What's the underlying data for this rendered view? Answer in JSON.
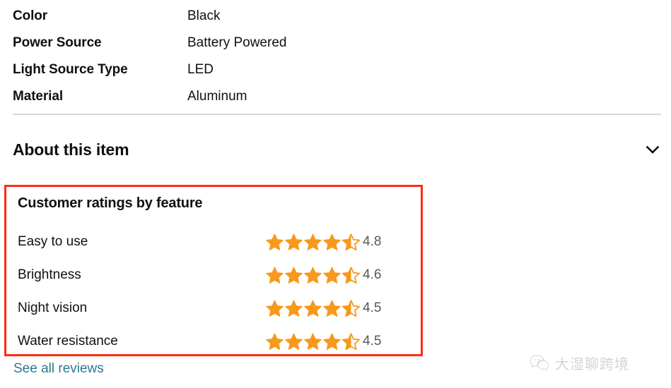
{
  "specs": {
    "rows": [
      {
        "label": "Color",
        "value": "Black"
      },
      {
        "label": "Power Source",
        "value": "Battery Powered"
      },
      {
        "label": "Light Source Type",
        "value": "LED"
      },
      {
        "label": "Material",
        "value": "Aluminum"
      }
    ]
  },
  "about": {
    "title": "About this item",
    "expand_icon": "chevron-down-icon"
  },
  "ratings": {
    "title": "Customer ratings by feature",
    "star_color": "#F7991C",
    "star_outline_color": "#F7991C",
    "highlight_color": "#FF2D15",
    "features": [
      {
        "name": "Easy to use",
        "score": "4.8",
        "full_stars": 4,
        "half_star": true,
        "max_stars": 5
      },
      {
        "name": "Brightness",
        "score": "4.6",
        "full_stars": 4,
        "half_star": true,
        "max_stars": 5
      },
      {
        "name": "Night vision",
        "score": "4.5",
        "full_stars": 4,
        "half_star": true,
        "max_stars": 5
      },
      {
        "name": "Water resistance",
        "score": "4.5",
        "full_stars": 4,
        "half_star": true,
        "max_stars": 5
      }
    ]
  },
  "links": {
    "see_all_reviews": "See all reviews",
    "link_color": "#2B7A8C"
  },
  "watermark": {
    "text": "大湿聊跨境",
    "icon": "wechat-icon"
  }
}
